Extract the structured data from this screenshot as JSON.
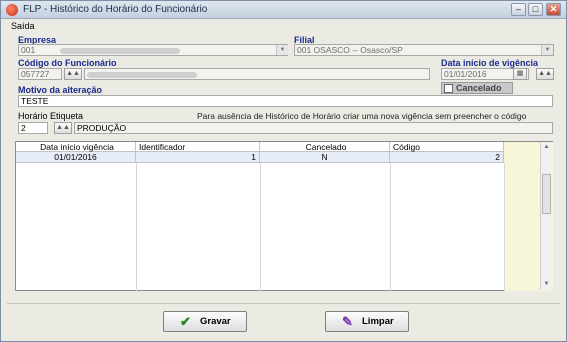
{
  "window": {
    "title": "FLP - Histórico do Horário do Funcionário"
  },
  "menu": {
    "items": [
      "Saída"
    ]
  },
  "form": {
    "empresa_label": "Empresa",
    "empresa_value": "001",
    "filial_label": "Filial",
    "filial_value": "001 OSASCO -- Osasco/SP",
    "codigo_label": "Código do Funcionário",
    "codigo_value": "057727",
    "data_inicio_label": "Data início de vigência",
    "data_inicio_value": "01/01/2016",
    "cancelado_label": "Cancelado",
    "motivo_label": "Motivo da alteração",
    "motivo_value": "TESTE",
    "horario_label": "Horário Etiqueta",
    "horario_code": "2",
    "horario_desc": "PRODUÇÃO",
    "hint": "Para ausência de Histórico de Horário criar uma nova vigência sem preencher o código"
  },
  "grid": {
    "columns": [
      "Data início vigência",
      "Identificador",
      "Cancelado",
      "Código"
    ],
    "rows": [
      {
        "data": "01/01/2016",
        "identificador": "1",
        "cancelado": "N",
        "codigo": "2"
      }
    ]
  },
  "buttons": {
    "gravar": "Gravar",
    "limpar": "Limpar"
  },
  "icons": {
    "app": "app-logo-icon",
    "minimize": "minimize-icon",
    "maximize": "maximize-icon",
    "close": "close-icon",
    "lookup": "binoculars-icon",
    "calendar": "calendar-icon",
    "gravar": "checkmark-icon",
    "limpar": "eraser-icon"
  },
  "colors": {
    "label_accent": "#1a2a8a",
    "selected_row": "#e7edf8",
    "grid_filler": "#f8f6d8",
    "gravar_check": "#1e8a1e"
  }
}
